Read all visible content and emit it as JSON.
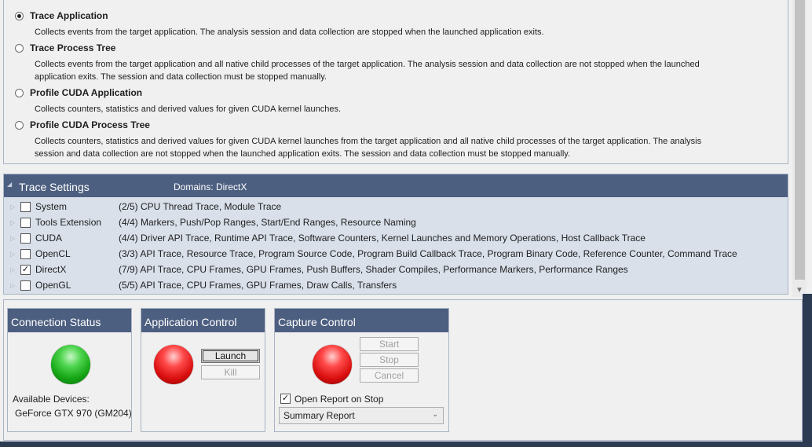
{
  "activities": [
    {
      "label": "Trace Application",
      "checked": true,
      "description": "Collects events from the target application. The analysis session and data collection are stopped when the launched application exits."
    },
    {
      "label": "Trace Process Tree",
      "checked": false,
      "description_lines": [
        "Collects events from the target application and all native child processes of the target application. The analysis session and data collection are not stopped when the launched",
        "application exits. The session and data collection must be stopped manually."
      ]
    },
    {
      "label": "Profile CUDA Application",
      "checked": false,
      "description": "Collects counters, statistics and derived values for given CUDA kernel launches."
    },
    {
      "label": "Profile CUDA Process Tree",
      "checked": false,
      "description_lines": [
        "Collects counters, statistics and derived values for given CUDA kernel launches from the target application and all native child processes of the target application. The analysis",
        "session and data collection are not stopped when the launched application exits. The session and data collection must be stopped manually."
      ]
    }
  ],
  "trace_settings": {
    "title": "Trace Settings",
    "domains_label": "Domains:  DirectX",
    "domains": [
      {
        "name": "System",
        "checked": false,
        "detail": "(2/5) CPU Thread Trace, Module Trace"
      },
      {
        "name": "Tools Extension",
        "checked": false,
        "detail": "(4/4) Markers, Push/Pop Ranges, Start/End Ranges, Resource Naming"
      },
      {
        "name": "CUDA",
        "checked": false,
        "detail": "(4/4) Driver API Trace, Runtime API Trace, Software Counters, Kernel Launches and Memory Operations, Host Callback Trace"
      },
      {
        "name": "OpenCL",
        "checked": false,
        "detail": "(3/3) API Trace, Resource Trace, Program Source Code, Program Build Callback Trace, Program Binary Code, Reference Counter, Command Trace"
      },
      {
        "name": "DirectX",
        "checked": true,
        "detail": "(7/9) API Trace, CPU Frames, GPU Frames, Push Buffers, Shader Compiles, Performance Markers, Performance Ranges"
      },
      {
        "name": "OpenGL",
        "checked": false,
        "detail": "(5/5) API Trace, CPU Frames, GPU Frames, Draw Calls, Transfers"
      }
    ]
  },
  "connection_status": {
    "title": "Connection Status",
    "status_color": "#22b422",
    "devices_label": "Available Devices:",
    "device": "GeForce GTX 970 (GM204)"
  },
  "application_control": {
    "title": "Application Control",
    "status_color": "#e01818",
    "launch_label": "Launch",
    "kill_label": "Kill"
  },
  "capture_control": {
    "title": "Capture Control",
    "status_color": "#e01818",
    "start_label": "Start",
    "stop_label": "Stop",
    "cancel_label": "Cancel",
    "open_report_label": "Open Report on Stop",
    "open_report_checked": true,
    "report_type": "Summary Report"
  }
}
